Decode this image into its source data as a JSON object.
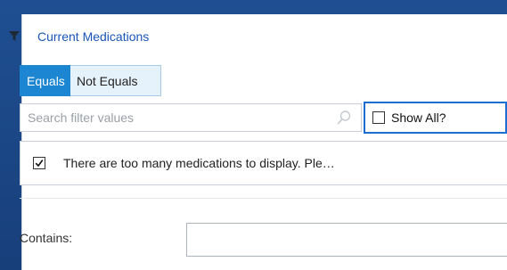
{
  "filter": {
    "title": "Current Medications",
    "icon": "funnel-icon"
  },
  "tabs": [
    {
      "label": "Equals",
      "active": true
    },
    {
      "label": "Not Equals",
      "active": false
    }
  ],
  "search": {
    "placeholder": "Search filter values",
    "value": "",
    "icon": "search-icon"
  },
  "show_all": {
    "label": "Show All?",
    "checked": false
  },
  "notice": {
    "text": "There are too many medications to display. Ple…",
    "checked": true
  },
  "contains": {
    "label": "Contains:",
    "value": ""
  },
  "colors": {
    "background": "#1f4f92",
    "accent": "#1c86d3",
    "title": "#1a55b8",
    "focus_border": "#1c6fd1"
  }
}
